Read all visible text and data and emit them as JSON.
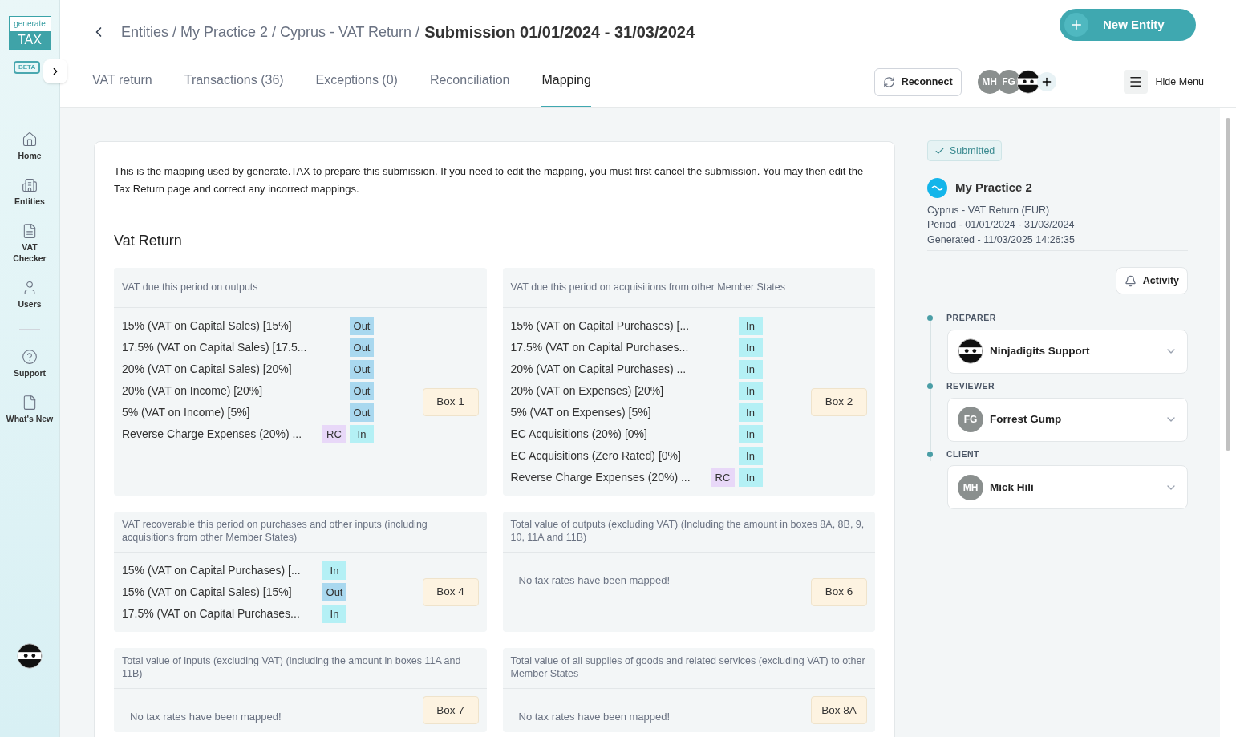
{
  "sidebar": {
    "logo": {
      "top": "generate",
      "bottom": "TAX"
    },
    "badge": "BETA",
    "items": [
      {
        "kind": "nav",
        "label": "Home"
      },
      {
        "kind": "nav",
        "label": "Entities"
      },
      {
        "kind": "nav",
        "label": "VAT Checker"
      },
      {
        "kind": "nav",
        "label": "Users"
      },
      {
        "kind": "divider"
      },
      {
        "kind": "nav",
        "label": "Support"
      },
      {
        "kind": "nav",
        "label": "What's New"
      }
    ]
  },
  "header": {
    "breadcrumb": "Entities / My Practice 2 / Cyprus - VAT Return /",
    "title": "Submission 01/01/2024 - 31/03/2024",
    "new_button": "New Entity",
    "tabs": [
      {
        "label": "VAT return",
        "selected": false
      },
      {
        "label": "Transactions (36)",
        "selected": false
      },
      {
        "label": "Exceptions (0)",
        "selected": false
      },
      {
        "label": "Reconciliation",
        "selected": false
      },
      {
        "label": "Mapping",
        "selected": true
      }
    ],
    "reconnect": "Reconnect",
    "avatars": [
      {
        "kind": "initials",
        "text": "MH"
      },
      {
        "kind": "initials",
        "text": "FG"
      },
      {
        "kind": "ninja"
      }
    ],
    "hide_menu": "Hide Menu"
  },
  "main": {
    "intro": "This is the mapping used by generate.TAX to prepare this submission. If you need to edit the mapping, you must first cancel the submission. You may then edit the Tax Return page and correct any incorrect mappings.",
    "heading": "Vat Return",
    "sections": [
      {
        "title": "VAT due this period on outputs",
        "box": "Box 1",
        "rows": [
          {
            "label": "15% (VAT on Capital Sales) [15%]",
            "tags": [
              {
                "kind": "out",
                "text": "Out"
              }
            ]
          },
          {
            "label": "17.5% (VAT on Capital Sales) [17.5...",
            "tags": [
              {
                "kind": "out",
                "text": "Out"
              }
            ]
          },
          {
            "label": "20% (VAT on Capital Sales) [20%]",
            "tags": [
              {
                "kind": "out",
                "text": "Out"
              }
            ]
          },
          {
            "label": "20% (VAT on Income) [20%]",
            "tags": [
              {
                "kind": "out",
                "text": "Out"
              }
            ]
          },
          {
            "label": "5% (VAT on Income) [5%]",
            "tags": [
              {
                "kind": "out",
                "text": "Out"
              }
            ]
          },
          {
            "label": "Reverse Charge Expenses (20%) ...",
            "tags": [
              {
                "kind": "rc",
                "text": "RC"
              },
              {
                "kind": "in",
                "text": "In"
              }
            ]
          }
        ]
      },
      {
        "title": "VAT due this period on acquisitions from other Member States",
        "box": "Box 2",
        "rows": [
          {
            "label": "15% (VAT on Capital Purchases) [...",
            "tags": [
              {
                "kind": "in",
                "text": "In"
              }
            ]
          },
          {
            "label": "17.5% (VAT on Capital Purchases...",
            "tags": [
              {
                "kind": "in",
                "text": "In"
              }
            ]
          },
          {
            "label": "20% (VAT on Capital Purchases) ...",
            "tags": [
              {
                "kind": "in",
                "text": "In"
              }
            ]
          },
          {
            "label": "20% (VAT on Expenses) [20%]",
            "tags": [
              {
                "kind": "in",
                "text": "In"
              }
            ]
          },
          {
            "label": "5% (VAT on Expenses) [5%]",
            "tags": [
              {
                "kind": "in",
                "text": "In"
              }
            ]
          },
          {
            "label": "EC Acquisitions (20%) [0%]",
            "tags": [
              {
                "kind": "in",
                "text": "In"
              }
            ]
          },
          {
            "label": "EC Acquisitions (Zero Rated) [0%]",
            "tags": [
              {
                "kind": "in",
                "text": "In"
              }
            ]
          },
          {
            "label": "Reverse Charge Expenses (20%) ...",
            "tags": [
              {
                "kind": "rc",
                "text": "RC"
              },
              {
                "kind": "in",
                "text": "In"
              }
            ]
          }
        ]
      },
      {
        "title": "VAT recoverable this period on purchases and other inputs (including acquisitions from other Member States)",
        "box": "Box 4",
        "rows": [
          {
            "label": "15% (VAT on Capital Purchases) [...",
            "tags": [
              {
                "kind": "in",
                "text": "In"
              }
            ]
          },
          {
            "label": "15% (VAT on Capital Sales) [15%]",
            "tags": [
              {
                "kind": "out",
                "text": "Out"
              }
            ]
          },
          {
            "label": "17.5% (VAT on Capital Purchases...",
            "tags": [
              {
                "kind": "in",
                "text": "In"
              }
            ]
          }
        ]
      },
      {
        "title": "Total value of outputs (excluding VAT) (Including the amount in boxes 8A, 8B, 9, 10, 11A and 11B)",
        "box": "Box 6",
        "empty_text": "No tax rates have been mapped!"
      },
      {
        "title": "Total value of inputs (excluding VAT) (including the amount in boxes 11A and 11B)",
        "box": "Box 7",
        "empty_text": "No tax rates have been mapped!"
      },
      {
        "title": "Total value of all supplies of goods and related services (excluding VAT) to other Member States",
        "box": "Box 8A",
        "empty_text": "No tax rates have been mapped!"
      }
    ]
  },
  "panel": {
    "status": "Submitted",
    "practice": "My Practice 2",
    "details": [
      "Cyprus - VAT Return (EUR)",
      "Period - 01/01/2024 - 31/03/2024",
      "Generated - 11/03/2025 14:26:35"
    ],
    "activity": "Activity",
    "roles": [
      {
        "label": "PREPARER",
        "person": {
          "kind": "ninja",
          "name": "Ninjadigits Support"
        }
      },
      {
        "label": "REVIEWER",
        "person": {
          "kind": "initials",
          "initials": "FG",
          "name": "Forrest Gump"
        }
      },
      {
        "label": "CLIENT",
        "person": {
          "kind": "initials",
          "initials": "MH",
          "name": "Mick Hili"
        }
      }
    ]
  }
}
